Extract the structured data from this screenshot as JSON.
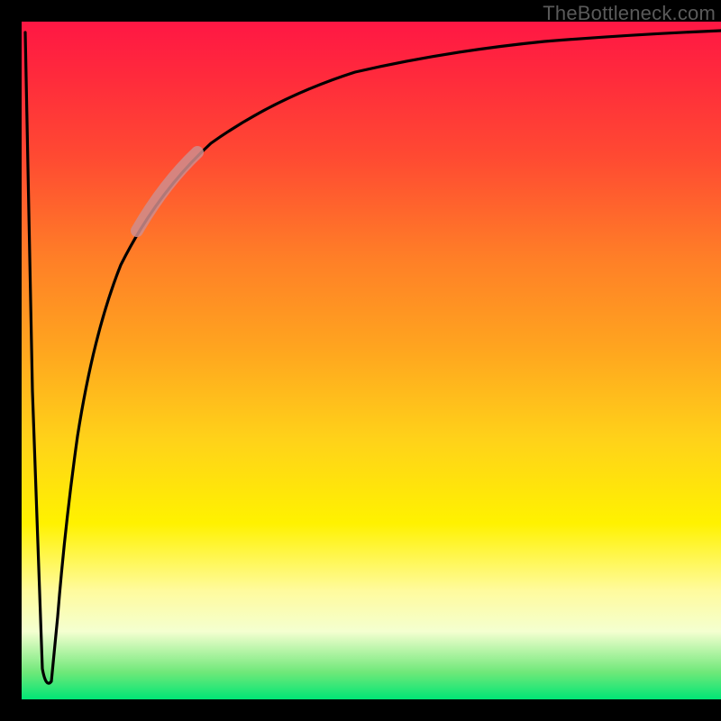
{
  "watermark": "TheBottleneck.com",
  "chart_data": {
    "type": "line",
    "title": "",
    "xlabel": "",
    "ylabel": "",
    "xlim": [
      0,
      100
    ],
    "ylim": [
      0,
      100
    ],
    "grid": false,
    "legend_position": "none",
    "series": [
      {
        "name": "bottleneck-curve",
        "x": [
          0.5,
          1.5,
          3,
          4,
          5,
          6,
          8,
          10,
          13,
          16,
          20,
          25,
          30,
          35,
          40,
          50,
          60,
          70,
          80,
          90,
          100
        ],
        "y": [
          98,
          45,
          3,
          2,
          10,
          25,
          45,
          58,
          68,
          75,
          80,
          84,
          87,
          89,
          90.5,
          92.5,
          93.8,
          94.7,
          95.3,
          95.8,
          96.2
        ]
      }
    ],
    "annotations": [
      {
        "name": "highlight-segment",
        "x_range": [
          16,
          23
        ],
        "note": "thick pale overlay on curve"
      }
    ],
    "colors": {
      "curve": "#000000",
      "highlight": "#d08a8a",
      "gradient_top": "#ff1744",
      "gradient_bottom": "#00e676",
      "frame": "#000000"
    }
  }
}
